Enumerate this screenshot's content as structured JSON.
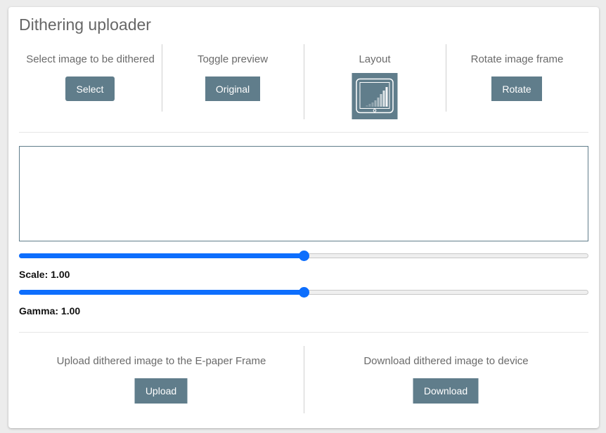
{
  "title": "Dithering uploader",
  "controls": {
    "select": {
      "label": "Select image to be dithered",
      "button": "Select"
    },
    "preview": {
      "label": "Toggle preview",
      "button": "Original"
    },
    "layout": {
      "label": "Layout",
      "icon": "frame-layout-icon"
    },
    "rotate": {
      "label": "Rotate image frame",
      "button": "Rotate"
    }
  },
  "sliders": {
    "scale": {
      "label": "Scale:",
      "value": "1.00",
      "level": 0.5
    },
    "gamma": {
      "label": "Gamma:",
      "value": "1.00",
      "level": 0.5
    }
  },
  "actions": {
    "upload": {
      "label": "Upload dithered image to the E-paper Frame",
      "button": "Upload"
    },
    "download": {
      "label": "Download dithered image to device",
      "button": "Download"
    }
  },
  "colors": {
    "button": "#607d8b",
    "accent": "#0d6efd"
  }
}
